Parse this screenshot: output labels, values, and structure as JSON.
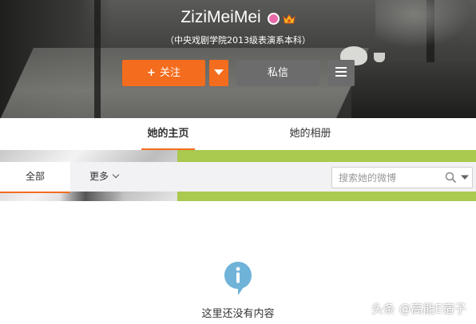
{
  "profile": {
    "name": "ZiziMeiMei",
    "description": "（中央戏剧学院2013级表演系本科）",
    "badges": [
      "pink-circle-badge-icon",
      "crown-badge-icon"
    ]
  },
  "actions": {
    "follow_plus": "+",
    "follow_label": "关注",
    "message_label": "私信"
  },
  "main_tabs": [
    {
      "label": "她的主页",
      "active": true
    },
    {
      "label": "她的相册",
      "active": false
    }
  ],
  "subnav": {
    "all_label": "全部",
    "more_label": "更多",
    "search_placeholder": "搜索她的微博"
  },
  "empty_state": {
    "message": "这里还没有内容",
    "icon": "info-icon"
  },
  "watermark": "头条 @高能E宿子",
  "colors": {
    "accent": "#f46c1d",
    "secondary_button": "#6c6c6c",
    "strip_green": "#a9c94f",
    "info_blue": "#6fb3d8"
  }
}
